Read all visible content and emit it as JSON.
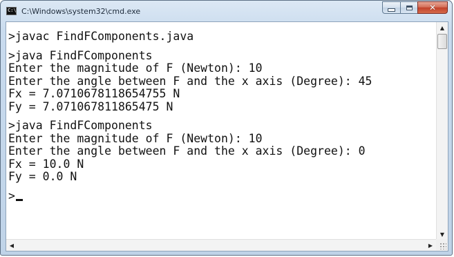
{
  "window": {
    "title": "C:\\Windows\\system32\\cmd.exe",
    "icon": "cmd-icon",
    "icon_text": "C:\\"
  },
  "caption_buttons": {
    "minimize_icon": "minimize-icon",
    "maximize_icon": "maximize-icon",
    "close_icon": "close-icon",
    "close_glyph": "✕"
  },
  "console": {
    "lines": [
      "",
      ">javac FindFComponents.java",
      "",
      ">java FindFComponents",
      "Enter the magnitude of F (Newton): 10",
      "Enter the angle between F and the x axis (Degree): 45",
      "Fx = 7.0710678118654755 N",
      "Fy = 7.071067811865475 N",
      "",
      ">java FindFComponents",
      "Enter the magnitude of F (Newton): 10",
      "Enter the angle between F and the x axis (Degree): 0",
      "Fx = 10.0 N",
      "Fy = 0.0 N",
      "",
      ">"
    ]
  },
  "scrollbars": {
    "up_arrow": "▲",
    "down_arrow": "▼",
    "left_arrow": "◀",
    "right_arrow": "▶"
  },
  "colors": {
    "console_background": "#ffffff",
    "console_text": "#111111",
    "close_button": "#c2432b",
    "frame": "#c9dbee"
  }
}
